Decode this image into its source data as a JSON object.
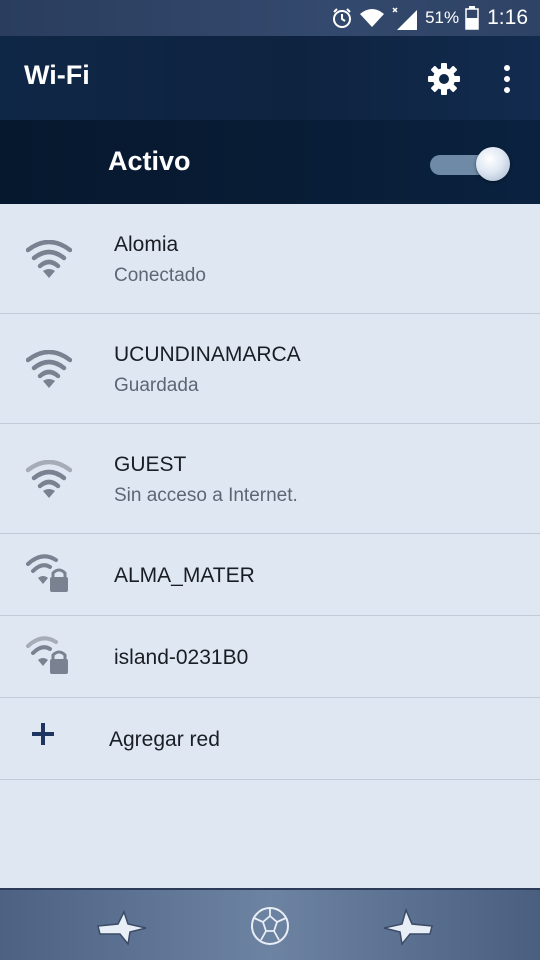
{
  "status_bar": {
    "battery_percent": "51%",
    "time": "1:16",
    "icons": [
      "alarm-icon",
      "wifi-icon",
      "signal-icon",
      "battery-icon"
    ]
  },
  "app_bar": {
    "title": "Wi-Fi",
    "icons": [
      "gear-icon",
      "more-vert-icon"
    ]
  },
  "master_switch": {
    "label": "Activo",
    "state": "on"
  },
  "networks": [
    {
      "name": "Alomia",
      "status": "Conectado",
      "icon": "wifi-signal-icon",
      "secured": false
    },
    {
      "name": "UCUNDINAMARCA",
      "status": "Guardada",
      "icon": "wifi-signal-icon",
      "secured": false
    },
    {
      "name": "GUEST",
      "status": "Sin acceso a Internet.",
      "icon": "wifi-signal-icon",
      "secured": false
    },
    {
      "name": "ALMA_MATER",
      "status": "",
      "icon": "wifi-lock-icon",
      "secured": true
    },
    {
      "name": "island-0231B0",
      "status": "",
      "icon": "wifi-lock-icon",
      "secured": true
    }
  ],
  "add_network": {
    "label": "Agregar red",
    "icon": "plus-icon"
  },
  "bottom_bar": {
    "icons": [
      "star-left-icon",
      "football-icon",
      "star-right-icon"
    ]
  },
  "colors": {
    "app_bar": "#0f2746",
    "master_bar": "#081c35",
    "list_bg": "#dfe8f2",
    "divider": "#c2ccd8",
    "accent": "#1d3560"
  }
}
